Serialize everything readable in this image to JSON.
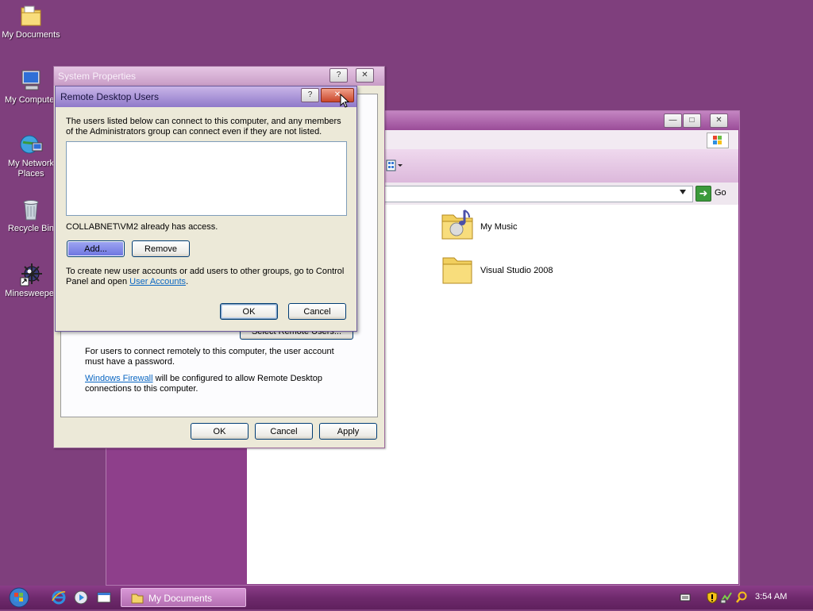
{
  "desktop": {
    "icons": [
      {
        "label": "My Documents",
        "icon": "folder-icon"
      },
      {
        "label": "My Computer",
        "icon": "computer-icon"
      },
      {
        "label": "My Network Places",
        "icon": "network-places-icon"
      },
      {
        "label": "Recycle Bin",
        "icon": "recycle-bin-icon"
      },
      {
        "label": "Minesweeper",
        "icon": "minesweeper-icon"
      }
    ]
  },
  "explorer": {
    "go_label": "Go",
    "items": [
      {
        "label": "My Music"
      },
      {
        "label": "Visual Studio 2008"
      }
    ]
  },
  "system_properties": {
    "title": "System Properties",
    "select_remote_users_label": "Select Remote Users...",
    "info_text": "For users to connect remotely to this computer, the user account must have a password.",
    "firewall_link": "Windows Firewall",
    "firewall_text": " will be configured to allow Remote Desktop connections to this computer.",
    "ok_label": "OK",
    "cancel_label": "Cancel",
    "apply_label": "Apply"
  },
  "remote_desktop_users": {
    "title": "Remote Desktop Users",
    "description": "The users listed below can connect to this computer, and any members of the Administrators group can connect even if they are not listed.",
    "access_text": "COLLABNET\\VM2 already has access.",
    "add_label": "Add...",
    "remove_label": "Remove",
    "info_text_1": "To create new user accounts or add users to other groups, go to Control Panel and open ",
    "user_accounts_link": "User Accounts",
    "info_text_2": ".",
    "ok_label": "OK",
    "cancel_label": "Cancel"
  },
  "taskbar": {
    "task_label": "My Documents",
    "clock": "3:54 AM"
  },
  "colors": {
    "desktop": "#7f3f7d",
    "link": "#0a66c2"
  }
}
